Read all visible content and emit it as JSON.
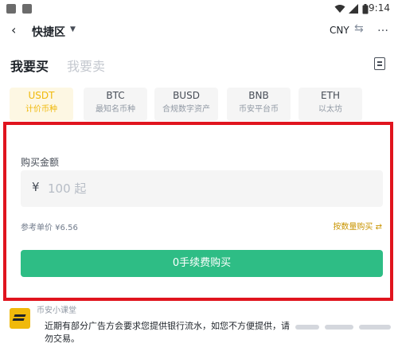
{
  "status_bar": {
    "time": "9:14"
  },
  "app_bar": {
    "title": "快捷区",
    "currency": "CNY"
  },
  "mode_tabs": {
    "buy": "我要买",
    "sell": "我要卖"
  },
  "coin_tabs": [
    {
      "symbol": "USDT",
      "desc": "计价币种"
    },
    {
      "symbol": "BTC",
      "desc": "最知名币种"
    },
    {
      "symbol": "BUSD",
      "desc": "合规数字资产"
    },
    {
      "symbol": "BNB",
      "desc": "币安平台币"
    },
    {
      "symbol": "ETH",
      "desc": "以太坊"
    }
  ],
  "form": {
    "label": "购买金额",
    "currency_symbol": "¥",
    "placeholder": "100 起",
    "reference_price": "参考单价 ¥6.56",
    "by_quantity": "按数量购买 ⇄",
    "buy_button": "0手续费购买"
  },
  "lesson": {
    "title": "币安小课堂",
    "notice": "近期有部分广告方会要求您提供银行流水，如您不方便提供，请勿交易。"
  },
  "colors": {
    "accent": "#f0b90b",
    "buy_green": "#2ebd85",
    "highlight_red": "#e0141e"
  }
}
